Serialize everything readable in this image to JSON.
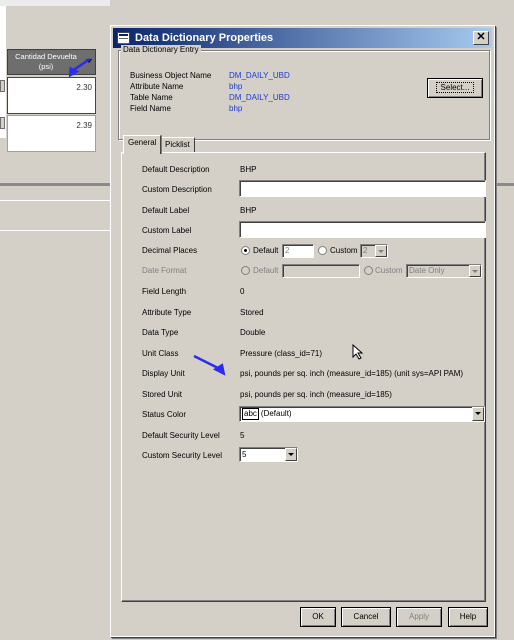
{
  "background": {
    "column_header": "Cantidad Devuelta (psi)",
    "cell_values": [
      "2.30",
      "2.39"
    ]
  },
  "dialog": {
    "title": "Data Dictionary Properties",
    "close_glyph": "✕",
    "entry_group": {
      "legend": "Data Dictionary Entry",
      "rows": [
        {
          "label": "Business Object Name",
          "value": "DM_DAILY_UBD"
        },
        {
          "label": "Attribute Name",
          "value": "bhp"
        },
        {
          "label": "Table Name",
          "value": "DM_DAILY_UBD"
        },
        {
          "label": "Field Name",
          "value": "bhp"
        }
      ],
      "select_button": "Select..."
    },
    "tabs": [
      {
        "label": "General",
        "active": true
      },
      {
        "label": "Picklist",
        "active": false
      }
    ],
    "general": {
      "default_description": {
        "label": "Default Description",
        "value": "BHP"
      },
      "custom_description": {
        "label": "Custom Description",
        "value": ""
      },
      "default_label": {
        "label": "Default Label",
        "value": "BHP"
      },
      "custom_label": {
        "label": "Custom Label",
        "value": ""
      },
      "decimal_places": {
        "label": "Decimal Places",
        "default_option": "Default",
        "default_value": "2",
        "custom_option": "Custom",
        "custom_value": "2",
        "selected": "Default"
      },
      "date_format": {
        "label": "Date Format",
        "default_option": "Default",
        "default_value": "",
        "custom_option": "Custom",
        "custom_value": "Date Only",
        "enabled": false
      },
      "field_length": {
        "label": "Field Length",
        "value": "0"
      },
      "attribute_type": {
        "label": "Attribute Type",
        "value": "Stored"
      },
      "data_type": {
        "label": "Data Type",
        "value": "Double"
      },
      "unit_class": {
        "label": "Unit Class",
        "value": "Pressure (class_id=71)"
      },
      "display_unit": {
        "label": "Display Unit",
        "value": "psi, pounds per sq. inch (measure_id=185) (unit sys=API PAM)"
      },
      "stored_unit": {
        "label": "Stored Unit",
        "value": "psi, pounds per sq. inch (measure_id=185)"
      },
      "status_color": {
        "label": "Status Color",
        "chip": "abc",
        "value": "(Default)"
      },
      "default_security_level": {
        "label": "Default Security Level",
        "value": "5"
      },
      "custom_security_level": {
        "label": "Custom Security Level",
        "value": "5"
      }
    },
    "buttons": {
      "ok": "OK",
      "cancel": "Cancel",
      "apply": "Apply",
      "help": "Help"
    }
  },
  "colors": {
    "titlebar_start": "#0a246a",
    "titlebar_end": "#a6caf0",
    "link_value": "#1a3bd9",
    "annotation_arrow": "#2b2bf0",
    "window_face": "#d4d0c8"
  }
}
